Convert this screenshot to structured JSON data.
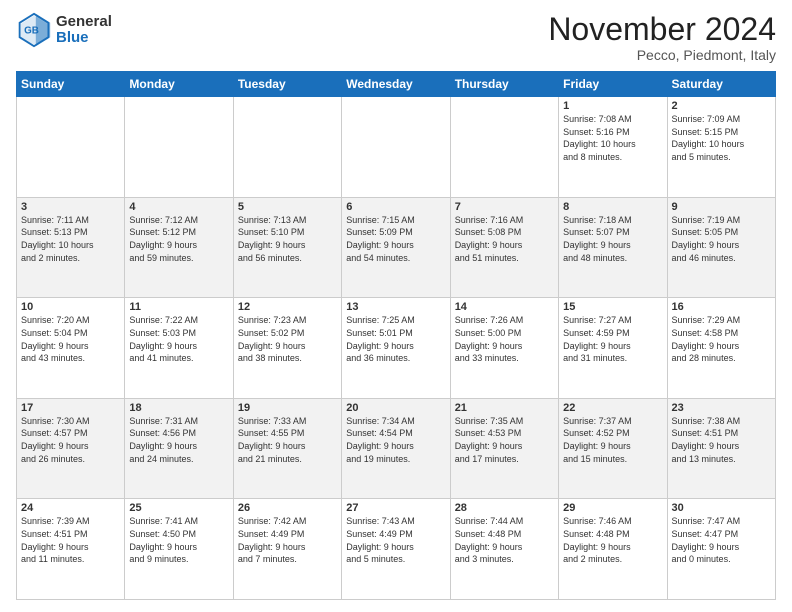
{
  "logo": {
    "general": "General",
    "blue": "Blue"
  },
  "header": {
    "month": "November 2024",
    "location": "Pecco, Piedmont, Italy"
  },
  "weekdays": [
    "Sunday",
    "Monday",
    "Tuesday",
    "Wednesday",
    "Thursday",
    "Friday",
    "Saturday"
  ],
  "weeks": [
    [
      {
        "day": "",
        "info": ""
      },
      {
        "day": "",
        "info": ""
      },
      {
        "day": "",
        "info": ""
      },
      {
        "day": "",
        "info": ""
      },
      {
        "day": "",
        "info": ""
      },
      {
        "day": "1",
        "info": "Sunrise: 7:08 AM\nSunset: 5:16 PM\nDaylight: 10 hours\nand 8 minutes."
      },
      {
        "day": "2",
        "info": "Sunrise: 7:09 AM\nSunset: 5:15 PM\nDaylight: 10 hours\nand 5 minutes."
      }
    ],
    [
      {
        "day": "3",
        "info": "Sunrise: 7:11 AM\nSunset: 5:13 PM\nDaylight: 10 hours\nand 2 minutes."
      },
      {
        "day": "4",
        "info": "Sunrise: 7:12 AM\nSunset: 5:12 PM\nDaylight: 9 hours\nand 59 minutes."
      },
      {
        "day": "5",
        "info": "Sunrise: 7:13 AM\nSunset: 5:10 PM\nDaylight: 9 hours\nand 56 minutes."
      },
      {
        "day": "6",
        "info": "Sunrise: 7:15 AM\nSunset: 5:09 PM\nDaylight: 9 hours\nand 54 minutes."
      },
      {
        "day": "7",
        "info": "Sunrise: 7:16 AM\nSunset: 5:08 PM\nDaylight: 9 hours\nand 51 minutes."
      },
      {
        "day": "8",
        "info": "Sunrise: 7:18 AM\nSunset: 5:07 PM\nDaylight: 9 hours\nand 48 minutes."
      },
      {
        "day": "9",
        "info": "Sunrise: 7:19 AM\nSunset: 5:05 PM\nDaylight: 9 hours\nand 46 minutes."
      }
    ],
    [
      {
        "day": "10",
        "info": "Sunrise: 7:20 AM\nSunset: 5:04 PM\nDaylight: 9 hours\nand 43 minutes."
      },
      {
        "day": "11",
        "info": "Sunrise: 7:22 AM\nSunset: 5:03 PM\nDaylight: 9 hours\nand 41 minutes."
      },
      {
        "day": "12",
        "info": "Sunrise: 7:23 AM\nSunset: 5:02 PM\nDaylight: 9 hours\nand 38 minutes."
      },
      {
        "day": "13",
        "info": "Sunrise: 7:25 AM\nSunset: 5:01 PM\nDaylight: 9 hours\nand 36 minutes."
      },
      {
        "day": "14",
        "info": "Sunrise: 7:26 AM\nSunset: 5:00 PM\nDaylight: 9 hours\nand 33 minutes."
      },
      {
        "day": "15",
        "info": "Sunrise: 7:27 AM\nSunset: 4:59 PM\nDaylight: 9 hours\nand 31 minutes."
      },
      {
        "day": "16",
        "info": "Sunrise: 7:29 AM\nSunset: 4:58 PM\nDaylight: 9 hours\nand 28 minutes."
      }
    ],
    [
      {
        "day": "17",
        "info": "Sunrise: 7:30 AM\nSunset: 4:57 PM\nDaylight: 9 hours\nand 26 minutes."
      },
      {
        "day": "18",
        "info": "Sunrise: 7:31 AM\nSunset: 4:56 PM\nDaylight: 9 hours\nand 24 minutes."
      },
      {
        "day": "19",
        "info": "Sunrise: 7:33 AM\nSunset: 4:55 PM\nDaylight: 9 hours\nand 21 minutes."
      },
      {
        "day": "20",
        "info": "Sunrise: 7:34 AM\nSunset: 4:54 PM\nDaylight: 9 hours\nand 19 minutes."
      },
      {
        "day": "21",
        "info": "Sunrise: 7:35 AM\nSunset: 4:53 PM\nDaylight: 9 hours\nand 17 minutes."
      },
      {
        "day": "22",
        "info": "Sunrise: 7:37 AM\nSunset: 4:52 PM\nDaylight: 9 hours\nand 15 minutes."
      },
      {
        "day": "23",
        "info": "Sunrise: 7:38 AM\nSunset: 4:51 PM\nDaylight: 9 hours\nand 13 minutes."
      }
    ],
    [
      {
        "day": "24",
        "info": "Sunrise: 7:39 AM\nSunset: 4:51 PM\nDaylight: 9 hours\nand 11 minutes."
      },
      {
        "day": "25",
        "info": "Sunrise: 7:41 AM\nSunset: 4:50 PM\nDaylight: 9 hours\nand 9 minutes."
      },
      {
        "day": "26",
        "info": "Sunrise: 7:42 AM\nSunset: 4:49 PM\nDaylight: 9 hours\nand 7 minutes."
      },
      {
        "day": "27",
        "info": "Sunrise: 7:43 AM\nSunset: 4:49 PM\nDaylight: 9 hours\nand 5 minutes."
      },
      {
        "day": "28",
        "info": "Sunrise: 7:44 AM\nSunset: 4:48 PM\nDaylight: 9 hours\nand 3 minutes."
      },
      {
        "day": "29",
        "info": "Sunrise: 7:46 AM\nSunset: 4:48 PM\nDaylight: 9 hours\nand 2 minutes."
      },
      {
        "day": "30",
        "info": "Sunrise: 7:47 AM\nSunset: 4:47 PM\nDaylight: 9 hours\nand 0 minutes."
      }
    ]
  ]
}
